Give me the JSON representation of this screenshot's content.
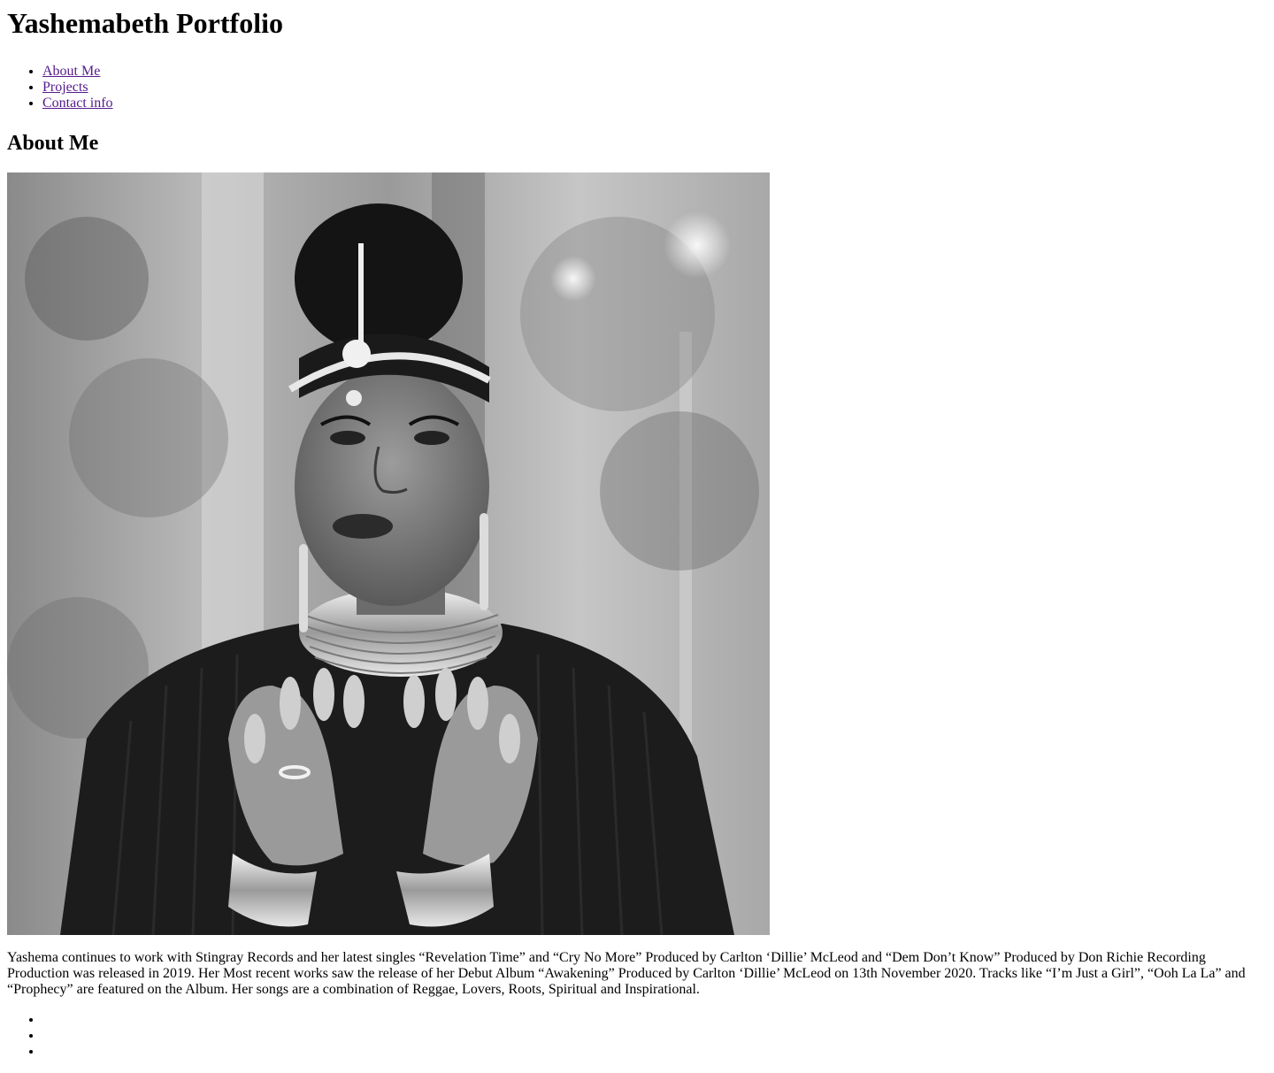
{
  "header": {
    "title": "Yashemabeth Portfolio"
  },
  "nav": {
    "items": [
      {
        "label": "About Me"
      },
      {
        "label": "Projects"
      },
      {
        "label": "Contact info"
      }
    ]
  },
  "about": {
    "heading": "About Me",
    "bio": "Yashema continues to work with Stingray Records and her latest singles “Revelation Time” and “Cry No More” Produced by Carlton ‘Dillie’ McLeod and “Dem Don’t Know” Produced by Don Richie Recording Production was released in 2019. Her Most recent works saw the release of her Debut Album “Awakening” Produced by Carlton ‘Dillie’ McLeod on 13th November 2020. Tracks like “I’m Just a Girl”, “Ooh La La” and “Prophecy” are featured on the Album. Her songs are a combination of Reggae, Lovers, Roots, Spiritual and Inspirational."
  },
  "social": {
    "items": [
      "",
      "",
      ""
    ]
  },
  "colors": {
    "link": "#551a8b",
    "text": "#000000",
    "background": "#ffffff"
  }
}
